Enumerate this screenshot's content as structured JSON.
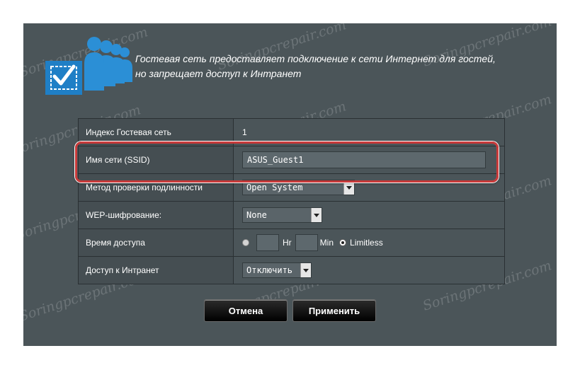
{
  "header": {
    "line1": "Гостевая сеть предоставляет подключение к сети Интернет для гостей,",
    "line2": "но запрещает доступ к Интранет"
  },
  "rows": {
    "index": {
      "label": "Индекс Гостевая сеть",
      "value": "1"
    },
    "ssid": {
      "label": "Имя сети (SSID)",
      "value": "ASUS_Guest1"
    },
    "auth": {
      "label": "Метод проверки подлинности",
      "value": "Open System"
    },
    "wep": {
      "label": "WEP-шифрование:",
      "value": "None"
    },
    "access_time": {
      "label": "Время доступа",
      "hr": "Hr",
      "min": "Min",
      "limitless": "Limitless"
    },
    "intranet": {
      "label": "Доступ к Интранет",
      "value": "Отключить"
    }
  },
  "buttons": {
    "cancel": "Отмена",
    "apply": "Применить"
  },
  "watermark": "Soringpcrepair.com",
  "colors": {
    "highlight": "#c83a3a",
    "panel": "#4b5559",
    "icon": "#2b8fd6"
  }
}
